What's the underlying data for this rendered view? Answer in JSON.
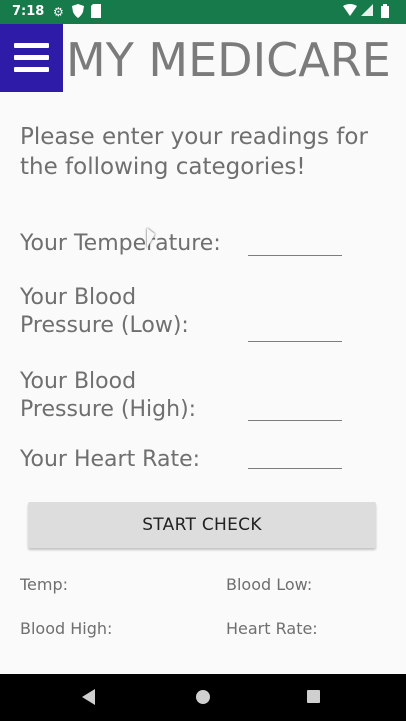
{
  "status_bar": {
    "time": "7:18",
    "icons": {
      "settings": "gear-icon",
      "shield": "shield-icon",
      "sim": "sim-card-icon",
      "wifi": "wifi-icon",
      "signal": "signal-icon",
      "battery": "battery-icon"
    }
  },
  "header": {
    "menu_icon": "hamburger-menu-icon",
    "title": "MY MEDICARE"
  },
  "intro": {
    "text": "Please enter your readings for the following categories!"
  },
  "readings": {
    "temperature": {
      "line1": "Your Temperature:",
      "line2": "",
      "value": "",
      "placeholder": ""
    },
    "blood_low": {
      "line1": "Your Blood",
      "line2": "Pressure (Low):",
      "value": "",
      "placeholder": ""
    },
    "blood_high": {
      "line1": "Your Blood",
      "line2": "Pressure (High):",
      "value": "",
      "placeholder": ""
    },
    "heart_rate": {
      "line1": "Your Heart Rate:",
      "line2": "",
      "value": "",
      "placeholder": ""
    }
  },
  "action": {
    "start_label": "START CHECK"
  },
  "results": {
    "temp": "Temp:",
    "blood_low": "Blood Low:",
    "blood_high": "Blood High:",
    "heart_rate": "Heart Rate:"
  },
  "nav_bar": {
    "back": "back-triangle-icon",
    "home": "home-circle-icon",
    "recents": "recents-square-icon"
  },
  "colors": {
    "status_bar": "#167a4a",
    "menu_button": "#2e1ba8",
    "text": "#6f6f6f",
    "button": "#dddddd",
    "nav_bar": "#000000"
  }
}
